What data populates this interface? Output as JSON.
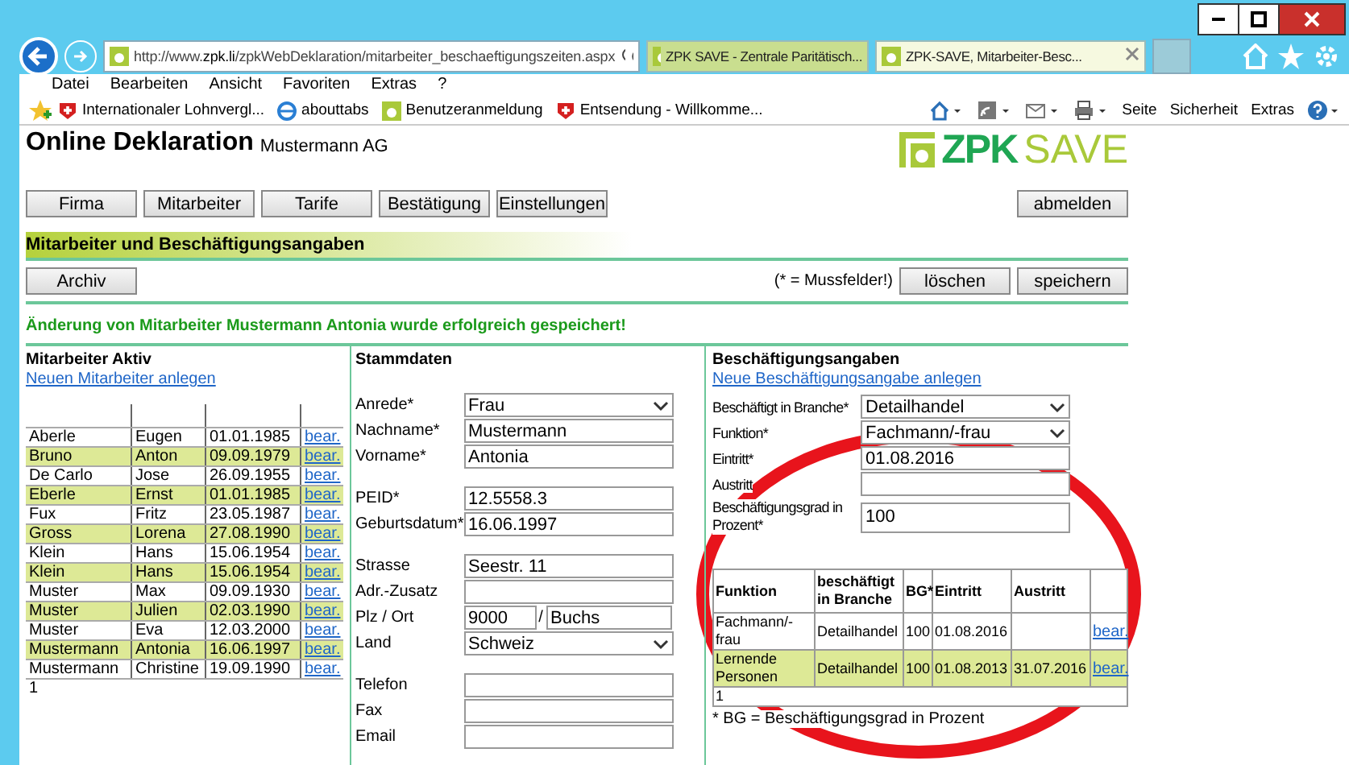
{
  "browser": {
    "address_host": "http://www.**zpk.li**/zpkWebDeklaration/mitarbeiter_beschaeftigungszeiten.aspx",
    "tabs": [
      {
        "title": "ZPK SAVE - Zentrale Paritätisch...",
        "selected": false
      },
      {
        "title": "ZPK-SAVE, Mitarbeiter-Besc...",
        "selected": true
      }
    ],
    "menu": [
      "Datei",
      "Bearbeiten",
      "Ansicht",
      "Favoriten",
      "Extras",
      "?"
    ],
    "favorites": [
      {
        "label": "Internationaler Lohnvergl...",
        "kind": "cross"
      },
      {
        "label": "abouttabs",
        "kind": "ie"
      },
      {
        "label": "Benutzeranmeldung",
        "kind": "zpk"
      },
      {
        "label": "Entsendung - Willkomme...",
        "kind": "cross"
      }
    ],
    "commands": [
      "Seite",
      "Sicherheit",
      "Extras"
    ]
  },
  "page": {
    "title": "Online Deklaration",
    "company": "Mustermann AG",
    "logo_a": "ZPK",
    "logo_b": "SAVE",
    "nav": [
      "Firma",
      "Mitarbeiter",
      "Tarife",
      "Bestätigung",
      "Einstellungen"
    ],
    "logout": "abmelden",
    "section_title": "Mitarbeiter und Beschäftigungsangaben",
    "archive": "Archiv",
    "required_note": "(* = Mussfelder!)",
    "delete": "löschen",
    "save": "speichern",
    "message": "Änderung von Mitarbeiter Mustermann Antonia wurde erfolgreich gespeichert!"
  },
  "employees": {
    "title": "Mitarbeiter Aktiv",
    "link": "Neuen Mitarbeiter anlegen",
    "rows": [
      [
        "Aberle",
        "Eugen",
        "01.01.1985",
        "bear."
      ],
      [
        "Bruno",
        "Anton",
        "09.09.1979",
        "bear."
      ],
      [
        "De Carlo",
        "Jose",
        "26.09.1955",
        "bear."
      ],
      [
        "Eberle",
        "Ernst",
        "01.01.1985",
        "bear."
      ],
      [
        "Fux",
        "Fritz",
        "23.05.1987",
        "bear."
      ],
      [
        "Gross",
        "Lorena",
        "27.08.1990",
        "bear."
      ],
      [
        "Klein",
        "Hans",
        "15.06.1954",
        "bear."
      ],
      [
        "Klein",
        "Hans",
        "15.06.1954",
        "bear."
      ],
      [
        "Muster",
        "Max",
        "09.09.1930",
        "bear."
      ],
      [
        "Muster",
        "Julien",
        "02.03.1990",
        "bear."
      ],
      [
        "Muster",
        "Eva",
        "12.03.2000",
        "bear."
      ],
      [
        "Mustermann",
        "Antonia",
        "16.06.1997",
        "bear."
      ],
      [
        "Mustermann",
        "Christine",
        "19.09.1990",
        "bear."
      ]
    ],
    "page": "1"
  },
  "master": {
    "title": "Stammdaten",
    "groups": [
      [
        {
          "label": "Anrede*",
          "kind": "select",
          "value": "Frau"
        },
        {
          "label": "Nachname*",
          "kind": "text",
          "value": "Mustermann"
        },
        {
          "label": "Vorname*",
          "kind": "text",
          "value": "Antonia"
        }
      ],
      [
        {
          "label": "PEID*",
          "kind": "text",
          "value": "12.5558.3"
        },
        {
          "label": "Geburtsdatum*",
          "kind": "text",
          "value": "16.06.1997"
        }
      ],
      [
        {
          "label": "Strasse",
          "kind": "text",
          "value": "Seestr. 11"
        },
        {
          "label": "Adr.-Zusatz",
          "kind": "text"
        },
        {
          "label": "Plz / Ort",
          "kind": "pair",
          "value": "9000",
          "separator": "/",
          "value_2": "Buchs"
        },
        {
          "label": "Land",
          "kind": "select",
          "value": "Schweiz"
        }
      ],
      [
        {
          "label": "Telefon",
          "kind": "text"
        },
        {
          "label": "Fax",
          "kind": "text"
        },
        {
          "label": "Email",
          "kind": "text"
        }
      ]
    ]
  },
  "employment": {
    "title": "Beschäftigungsangaben",
    "link": "Neue Beschäftigungsangabe anlegen",
    "fields": [
      {
        "label": "Beschäftigt in Branche*",
        "kind": "select",
        "value": "Detailhandel"
      },
      {
        "label": "Funktion*",
        "kind": "select",
        "value": "Fachmann/-frau"
      },
      {
        "label": "Eintritt*",
        "kind": "text",
        "value": "01.08.2016"
      },
      {
        "label": "Austritt",
        "kind": "text"
      },
      {
        "label": "Beschäftigungsgrad in Prozent*",
        "kind": "text",
        "value": "100"
      }
    ],
    "table": {
      "columns": [
        "Funktion",
        "beschäftigt in Branche",
        "BG*",
        "Eintritt",
        "Austritt"
      ],
      "rows": [
        [
          "Fachmann/-frau",
          "Detailhandel",
          "100",
          "01.08.2016",
          "",
          "bear."
        ],
        [
          "Lernende Personen",
          "Detailhandel",
          "100",
          "01.08.2013",
          "31.07.2016",
          "bear."
        ]
      ],
      "page": "1"
    },
    "footnote": "* BG = Beschäftigungsgrad in Prozent"
  },
  "annotation": {
    "kind": "ellipse"
  }
}
